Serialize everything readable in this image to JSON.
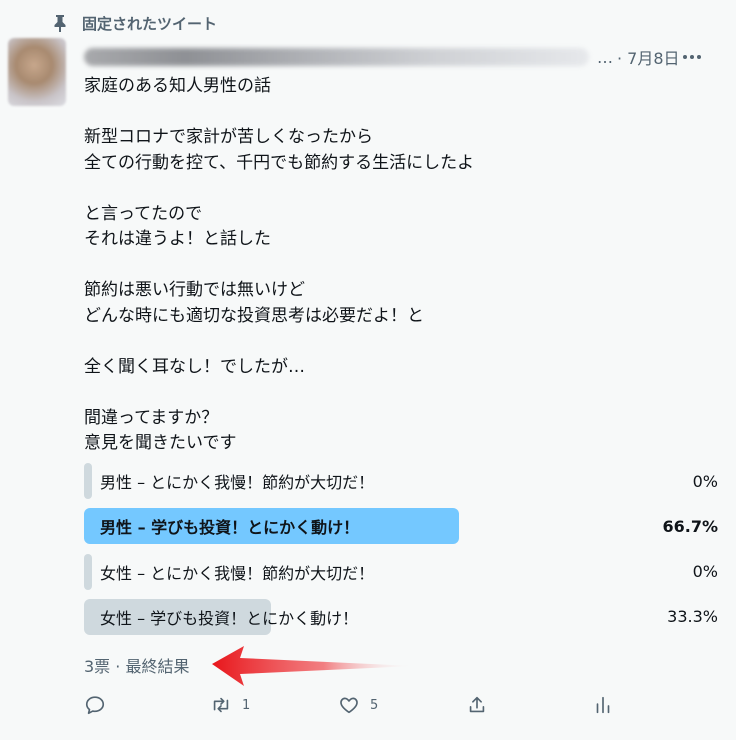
{
  "pinned": {
    "label": "固定されたツイート"
  },
  "tweet": {
    "separator": "…",
    "date": "· 7月8日",
    "text": "家庭のある知人男性の話\n\n新型コロナで家計が苦しくなったから\n全ての行動を控て、千円でも節約する生活にしたよ\n\nと言ってたので\nそれは違うよ！と話した\n\n節約は悪い行動では無いけど\nどんな時にも適切な投資思考は必要だよ！と\n\n全く聞く耳なし！でしたが…\n\n間違ってますか？\n意見を聞きたいです"
  },
  "poll": {
    "options": [
      {
        "label": "男性 – とにかく我慢！節約が大切だ！",
        "percent_text": "0%",
        "fraction": 0.0
      },
      {
        "label": "男性 – 学びも投資！とにかく動け！",
        "percent_text": "66.7%",
        "fraction": 0.667,
        "winner": true
      },
      {
        "label": "女性 – とにかく我慢！節約が大切だ！",
        "percent_text": "0%",
        "fraction": 0.0
      },
      {
        "label": "女性 – 学びも投資！とにかく動け！",
        "percent_text": "33.3%",
        "fraction": 0.333
      }
    ],
    "footer": "3票 · 最終結果"
  },
  "actions": {
    "reply_count": "",
    "retweet_count": "1",
    "like_count": "5"
  },
  "colors": {
    "winner_bar": "#74c8ff",
    "bar": "#cfd9de",
    "annotation_arrow": "#e8161b"
  },
  "icons": [
    "pin-icon",
    "more-icon",
    "reply-icon",
    "retweet-icon",
    "like-icon",
    "share-icon",
    "analytics-icon"
  ]
}
